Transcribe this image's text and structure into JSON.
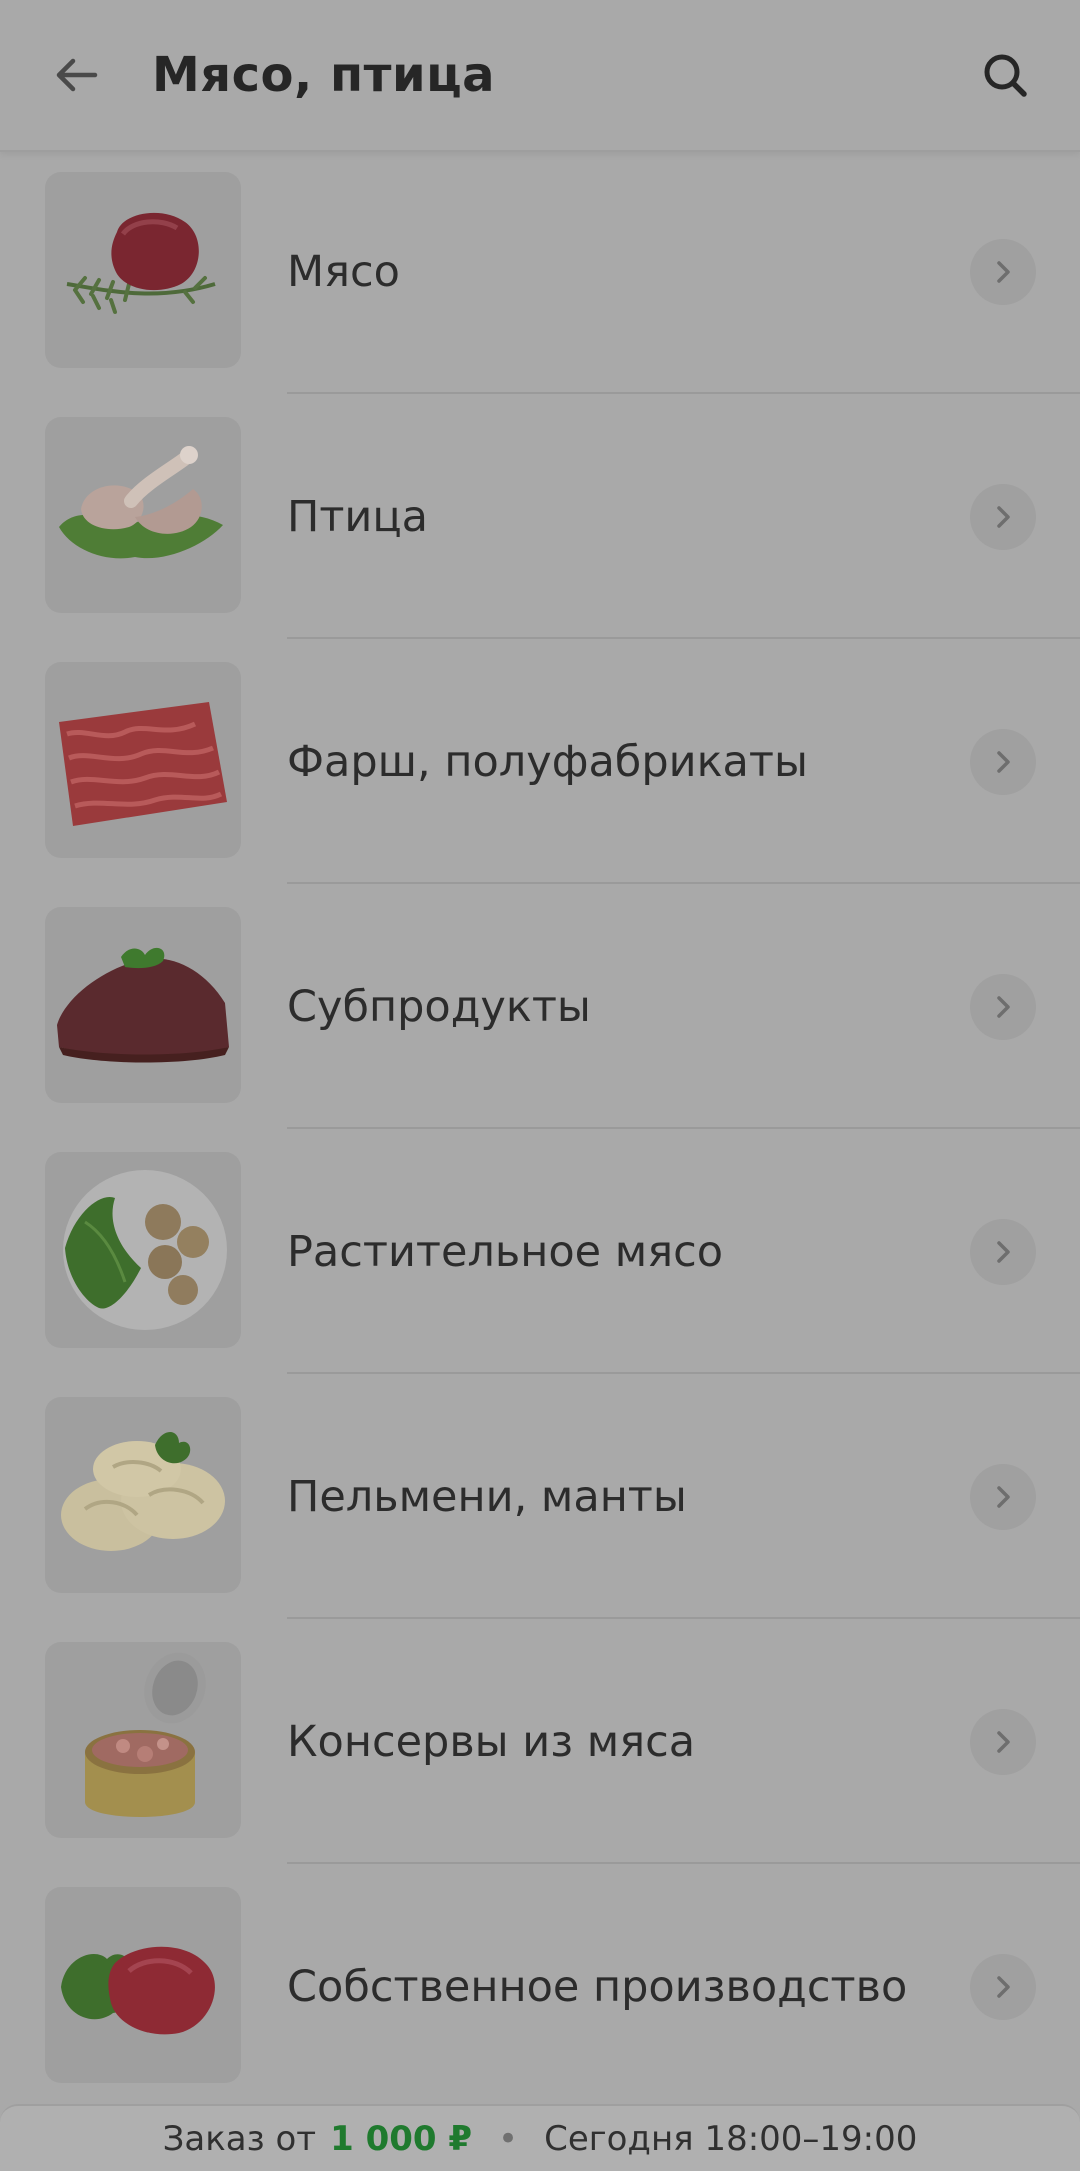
{
  "header": {
    "title": "Мясо, птица",
    "back_icon": "arrow-left-icon",
    "search_icon": "search-icon"
  },
  "categories": [
    {
      "label": "Мясо",
      "icon": "beef-image"
    },
    {
      "label": "Птица",
      "icon": "chicken-legs-image"
    },
    {
      "label": "Фарш, полуфабрикаты",
      "icon": "minced-meat-image"
    },
    {
      "label": "Субпродукты",
      "icon": "liver-image"
    },
    {
      "label": "Растительное мясо",
      "icon": "plant-meat-image"
    },
    {
      "label": "Пельмени, манты",
      "icon": "dumplings-image"
    },
    {
      "label": "Консервы из мяса",
      "icon": "canned-meat-image"
    },
    {
      "label": "Собственное производство",
      "icon": "own-production-meat-image"
    }
  ],
  "bottom_bar": {
    "order_prefix": "Заказ от",
    "min_amount": "1 000 ₽",
    "separator": "•",
    "delivery_slot": "Сегодня 18:00–19:00"
  },
  "colors": {
    "overlay_bg": "#a9a9a9",
    "accent_green": "#1f7a2e"
  }
}
